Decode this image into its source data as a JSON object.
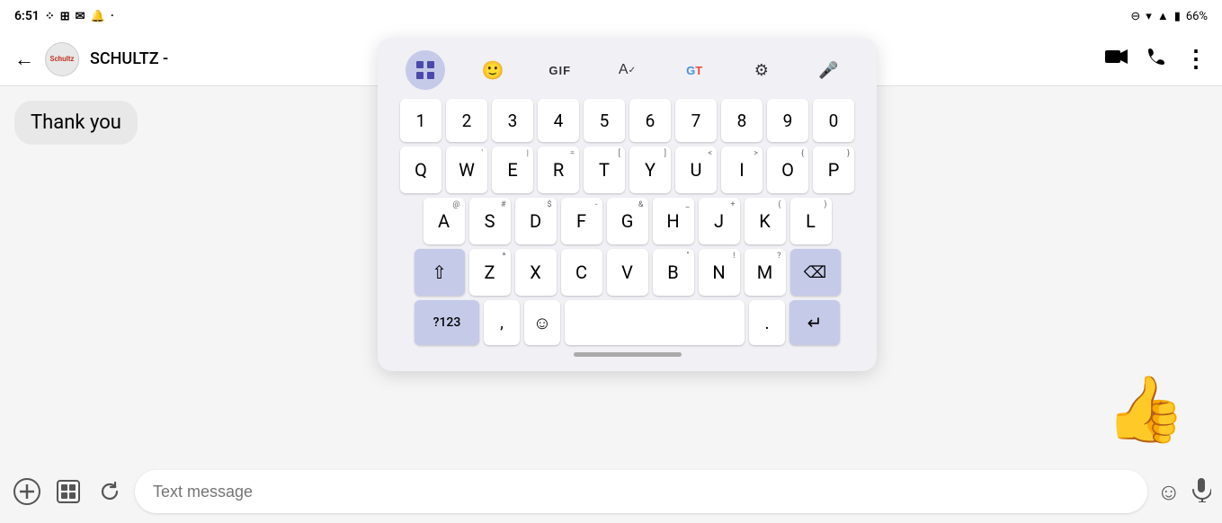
{
  "statusBar": {
    "time": "6:51",
    "batteryPercent": "66%",
    "icons": [
      "signal",
      "wifi",
      "battery"
    ]
  },
  "appBar": {
    "backLabel": "←",
    "contactName": "SCHULTZ -",
    "logoText": "Schultz",
    "videoCallIcon": "📹",
    "phoneIcon": "📞",
    "moreIcon": "⋮"
  },
  "messages": [
    {
      "text": "Thank you",
      "type": "received"
    }
  ],
  "thumbsUp": "👍",
  "inputBar": {
    "addIcon": "⊕",
    "galleryIcon": "🖼",
    "reactionIcon": "↺",
    "placeholder": "Text message",
    "emojiIcon": "☺",
    "micIcon": "🎤"
  },
  "keyboard": {
    "toolbar": [
      {
        "id": "emoji-grid",
        "icon": "⠿",
        "active": true
      },
      {
        "id": "sticker",
        "icon": "😄",
        "active": false
      },
      {
        "id": "gif",
        "label": "GIF",
        "active": false
      },
      {
        "id": "spell",
        "icon": "A✓",
        "active": false
      },
      {
        "id": "translate",
        "icon": "GT",
        "active": false
      },
      {
        "id": "settings",
        "icon": "⚙",
        "active": false
      },
      {
        "id": "mic",
        "icon": "🎤",
        "active": false
      }
    ],
    "numRow": [
      "1",
      "2",
      "3",
      "4",
      "5",
      "6",
      "7",
      "8",
      "9",
      "0"
    ],
    "row1": [
      {
        "k": "Q",
        "s": ""
      },
      {
        "k": "W",
        "s": "'"
      },
      {
        "k": "E",
        "s": "|"
      },
      {
        "k": "R",
        "s": "="
      },
      {
        "k": "T",
        "s": "["
      },
      {
        "k": "Y",
        "s": "]"
      },
      {
        "k": "U",
        "s": "<"
      },
      {
        "k": "I",
        "s": ">"
      },
      {
        "k": "O",
        "s": "{"
      },
      {
        "k": "P",
        "s": "}"
      }
    ],
    "row2": [
      {
        "k": "A",
        "s": "@"
      },
      {
        "k": "S",
        "s": "#"
      },
      {
        "k": "D",
        "s": "$"
      },
      {
        "k": "F",
        "s": "-"
      },
      {
        "k": "G",
        "s": "&"
      },
      {
        "k": "H",
        "s": "_"
      },
      {
        "k": "J",
        "s": "+"
      },
      {
        "k": "K",
        "s": "("
      },
      {
        "k": "L",
        "s": ")"
      }
    ],
    "row3": [
      {
        "k": "Z",
        "s": "*"
      },
      {
        "k": "X",
        "s": ""
      },
      {
        "k": "C",
        "s": ""
      },
      {
        "k": "V",
        "s": ""
      },
      {
        "k": "B",
        "s": "\""
      },
      {
        "k": "N",
        "s": "!"
      },
      {
        "k": "M",
        "s": "?"
      }
    ],
    "bottomRow": [
      {
        "k": "?123",
        "wide": false,
        "action": true
      },
      {
        "k": ",",
        "wide": false
      },
      {
        "k": "☺",
        "wide": false
      },
      {
        "k": "",
        "wide": true,
        "space": true
      },
      {
        "k": ".",
        "wide": false
      },
      {
        "k": "⌫",
        "wide": false,
        "action": true,
        "enter": true
      }
    ]
  }
}
